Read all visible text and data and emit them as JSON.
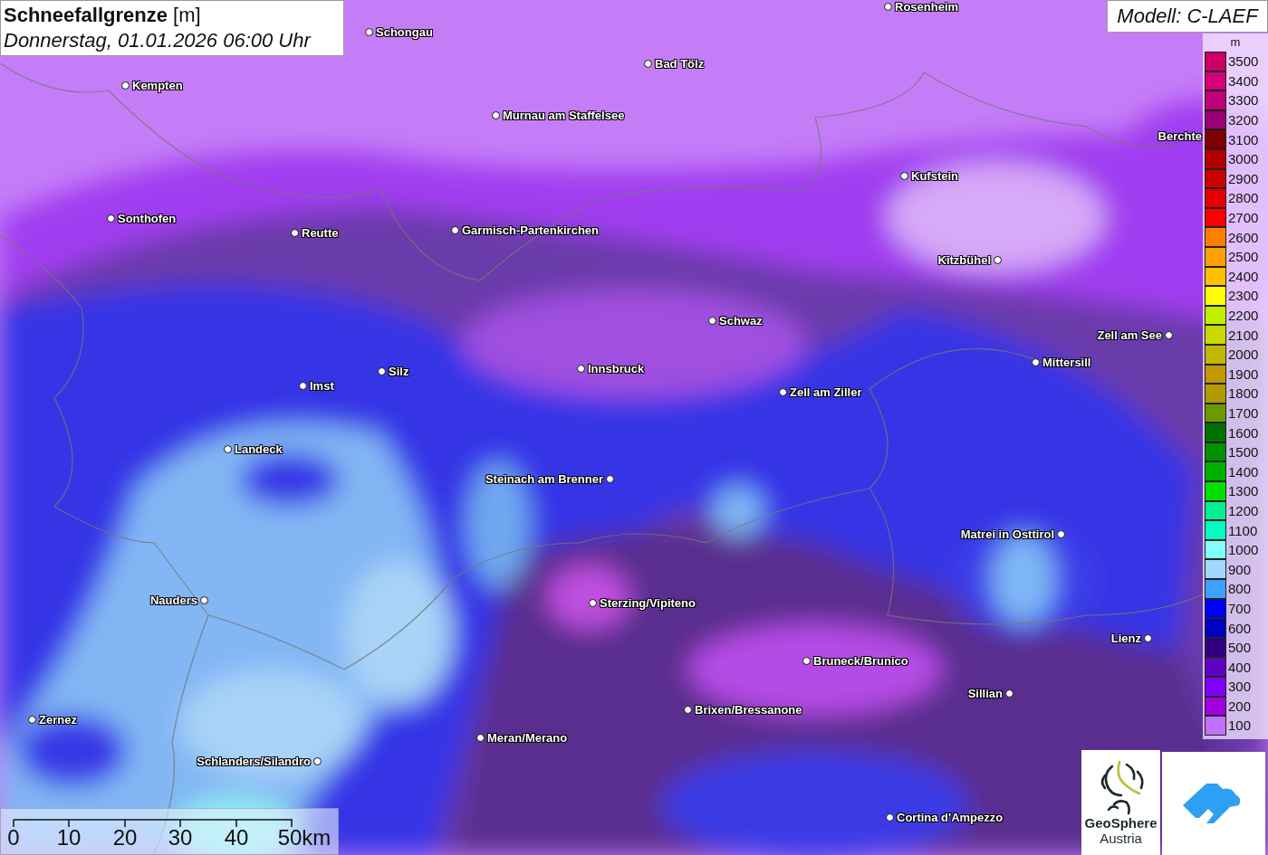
{
  "title": "**Schneefallgrenze** [m]",
  "subtitle": "Donnerstag, 01.01.2026 06:00 Uhr",
  "model": "Modell: C-LAEF",
  "cities": [
    {
      "name": "Rosenheim"
    },
    {
      "name": "Schongau"
    },
    {
      "name": "Kempten"
    },
    {
      "name": "Bad Tölz"
    },
    {
      "name": "Murnau am Staffelsee"
    },
    {
      "name": "Berchte"
    },
    {
      "name": "Kufstein"
    },
    {
      "name": "Sonthofen"
    },
    {
      "name": "Reutte"
    },
    {
      "name": "Garmisch-Partenkirchen"
    },
    {
      "name": "Kitzbühel"
    },
    {
      "name": "Schwaz"
    },
    {
      "name": "Zell am See"
    },
    {
      "name": "Mittersill"
    },
    {
      "name": "Innsbruck"
    },
    {
      "name": "Silz"
    },
    {
      "name": "Imst"
    },
    {
      "name": "Zell am Ziller"
    },
    {
      "name": "Landeck"
    },
    {
      "name": "Steinach am Brenner"
    },
    {
      "name": "Matrei in Osttirol"
    },
    {
      "name": "Nauders"
    },
    {
      "name": "Sterzing/Vipiteno"
    },
    {
      "name": "Lienz"
    },
    {
      "name": "Bruneck/Brunico"
    },
    {
      "name": "Sillian"
    },
    {
      "name": "Brixen/Bressanone"
    },
    {
      "name": "Zernez"
    },
    {
      "name": "Meran/Merano"
    },
    {
      "name": "Schlanders/Silandro"
    },
    {
      "name": "Cortina d'Ampezzo"
    }
  ],
  "legend": {
    "unit": "m",
    "items": [
      {
        "label": "3500",
        "color": "#cc0066"
      },
      {
        "label": "3400",
        "color": "#d4007a"
      },
      {
        "label": "3300",
        "color": "#c0007a"
      },
      {
        "label": "3200",
        "color": "#990077"
      },
      {
        "label": "3100",
        "color": "#800000"
      },
      {
        "label": "3000",
        "color": "#b30000"
      },
      {
        "label": "2900",
        "color": "#cc0000"
      },
      {
        "label": "2800",
        "color": "#e60000"
      },
      {
        "label": "2700",
        "color": "#ff0000"
      },
      {
        "label": "2600",
        "color": "#ff8000"
      },
      {
        "label": "2500",
        "color": "#ffa000"
      },
      {
        "label": "2400",
        "color": "#ffc000"
      },
      {
        "label": "2300",
        "color": "#ffff00"
      },
      {
        "label": "2200",
        "color": "#c0f000"
      },
      {
        "label": "2100",
        "color": "#c8d800"
      },
      {
        "label": "2000",
        "color": "#c0b800"
      },
      {
        "label": "1900",
        "color": "#c09800"
      },
      {
        "label": "1800",
        "color": "#b09a00"
      },
      {
        "label": "1700",
        "color": "#6a9a00"
      },
      {
        "label": "1600",
        "color": "#007000"
      },
      {
        "label": "1500",
        "color": "#009000"
      },
      {
        "label": "1400",
        "color": "#00b000"
      },
      {
        "label": "1300",
        "color": "#00e000"
      },
      {
        "label": "1200",
        "color": "#00f090"
      },
      {
        "label": "1100",
        "color": "#00ffc0"
      },
      {
        "label": "1000",
        "color": "#80ffff"
      },
      {
        "label": "900",
        "color": "#a0d8ff"
      },
      {
        "label": "800",
        "color": "#40a0ff"
      },
      {
        "label": "700",
        "color": "#0000ff"
      },
      {
        "label": "600",
        "color": "#0000c0"
      },
      {
        "label": "500",
        "color": "#300080"
      },
      {
        "label": "400",
        "color": "#6000c0"
      },
      {
        "label": "300",
        "color": "#8000ff"
      },
      {
        "label": "200",
        "color": "#a000e0"
      },
      {
        "label": "100",
        "color": "#c070ff"
      }
    ]
  },
  "scale_bar": {
    "labels": [
      "0",
      "10",
      "20",
      "30",
      "40",
      "50km"
    ]
  },
  "logo": {
    "line_1": "GeoSphere",
    "line_2": "Austria"
  }
}
